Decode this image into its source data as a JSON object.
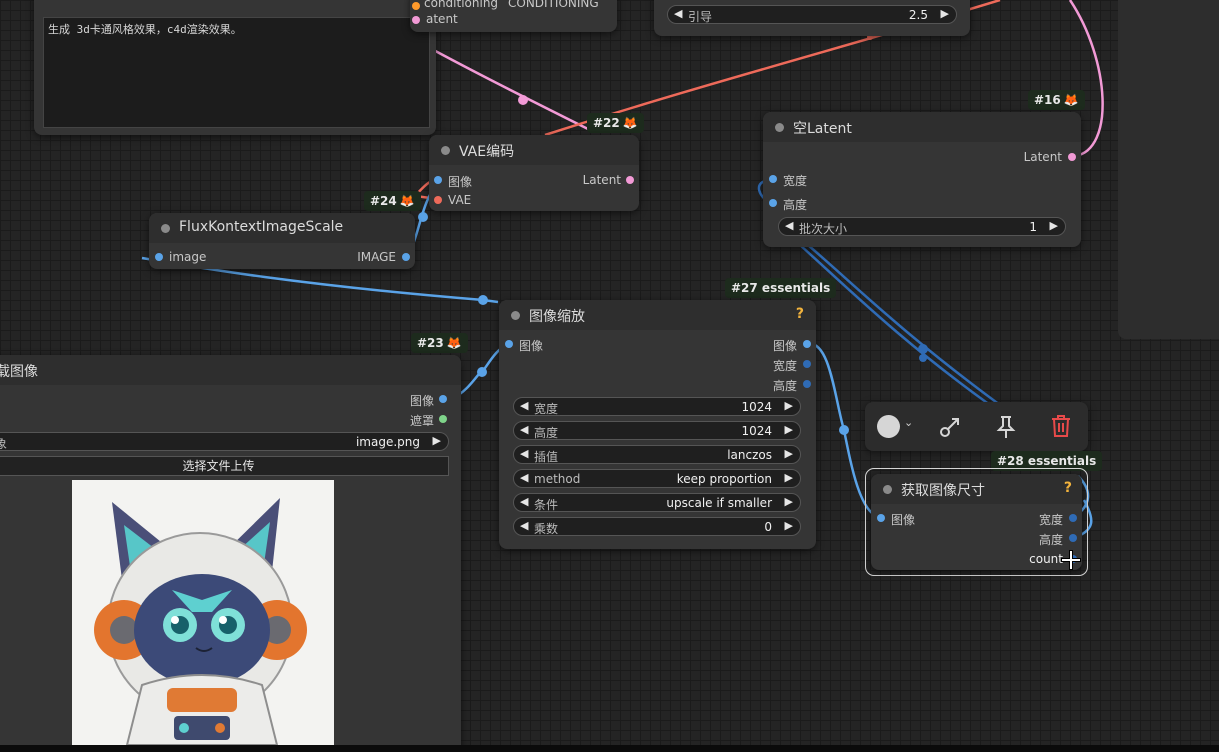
{
  "colors": {
    "canvas": "#242424",
    "node_bg": "#353535",
    "wire_image": "#5aa3e8",
    "wire_latent": "#f29ad6",
    "wire_vae": "#ee6a5a",
    "delete": "#e84a4a"
  },
  "top_nodes": {
    "prompt_text": "生成 3d卡通风格效果，c4d渲染效果。",
    "partial_slots": [
      "conditioning",
      "CONDITIONING",
      "atent"
    ],
    "guidance": {
      "label": "引导",
      "value": "2.5"
    }
  },
  "node16": {
    "badge": "#16",
    "title": "空Latent",
    "output": "Latent",
    "inputs": [
      "宽度",
      "高度"
    ],
    "widget": {
      "label": "批次大小",
      "value": "1"
    }
  },
  "node22": {
    "badge": "#22",
    "title": "VAE编码",
    "inputs": [
      "图像",
      "VAE"
    ],
    "output": "Latent"
  },
  "node24": {
    "badge": "#24",
    "title": "FluxKontextImageScale",
    "input": "image",
    "output": "IMAGE"
  },
  "node23": {
    "badge": "#23",
    "title": "载图像",
    "outputs": [
      "图像",
      "遮罩"
    ],
    "widget": {
      "label": "象",
      "value": "image.png"
    },
    "upload_label": "选择文件上传"
  },
  "node27": {
    "badge": "#27 essentials",
    "title": "图像缩放",
    "help": "?",
    "input": "图像",
    "outputs": [
      "图像",
      "宽度",
      "高度"
    ],
    "widgets": [
      {
        "label": "宽度",
        "value": "1024"
      },
      {
        "label": "高度",
        "value": "1024"
      },
      {
        "label": "插值",
        "value": "lanczos"
      },
      {
        "label": "method",
        "value": "keep proportion"
      },
      {
        "label": "条件",
        "value": "upscale if smaller"
      },
      {
        "label": "乘数",
        "value": "0"
      }
    ]
  },
  "node28": {
    "badge": "#28 essentials",
    "title": "获取图像尺寸",
    "help": "?",
    "input": "图像",
    "outputs": [
      "宽度",
      "高度",
      "count"
    ]
  },
  "toolbar": {
    "items": [
      "color-picker",
      "bypass-icon",
      "pin-icon",
      "trash-icon"
    ]
  }
}
